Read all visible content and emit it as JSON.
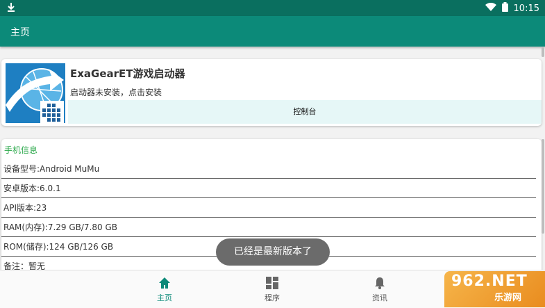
{
  "status": {
    "time": "10:15"
  },
  "appbar": {
    "title": "主页"
  },
  "app_card": {
    "name": "ExaGearET游戏启动器",
    "status_text": "启动器未安装，点击安装",
    "console_label": "控制台"
  },
  "info": {
    "heading": "手机信息",
    "rows": [
      "设备型号:Android MuMu",
      "安卓版本:6.0.1",
      "API版本:23",
      "RAM(内存):7.29 GB/7.80 GB",
      "ROM(储存):124 GB/126 GB",
      "备注：暂无"
    ]
  },
  "toast": "已经是最新版本了",
  "nav": [
    {
      "label": "主页",
      "icon": "home-icon",
      "active": true
    },
    {
      "label": "程序",
      "icon": "grid-icon",
      "active": false
    },
    {
      "label": "资讯",
      "icon": "bell-icon",
      "active": false
    }
  ],
  "watermark": {
    "big": "962.NET",
    "small": "乐游网"
  },
  "colors": {
    "accent": "#0c8a79",
    "statusbar": "#0a6f5f",
    "heading": "#2aa84a"
  }
}
